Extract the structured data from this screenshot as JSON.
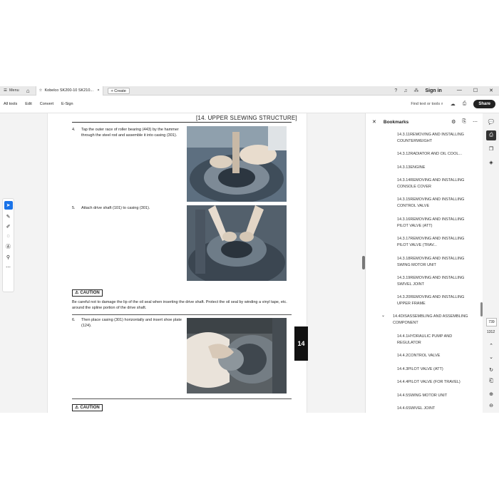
{
  "tabbar": {
    "menu_label": "Menu",
    "tab_title": "Kobelco SK200-10 SK210...",
    "create_label": "Create",
    "signin_label": "Sign in"
  },
  "toolbar": {
    "menus": [
      "All tools",
      "Edit",
      "Convert",
      "E-Sign"
    ],
    "find_label": "Find text or tools",
    "share_label": "Share"
  },
  "document": {
    "header": "[14.   UPPER SLEWING STRUCTURE]",
    "steps": [
      {
        "num": "4.",
        "text": "Tap the outer race of roller bearing (443) by the hammer through the steel rod and assemble it into casing (301)."
      },
      {
        "num": "5.",
        "text": "Attach drive shaft (101) to casing (301)."
      },
      {
        "num": "6.",
        "text": "Then place casing (301) horizontally and insert shoe plate (124)."
      }
    ],
    "caution_label": "CAUTION",
    "caution_text": "Be careful not to damage the lip of the oil seal when inserting the drive shaft. Protect the oil seal by winding a vinyl tape, etc. around the spline portion of the drive shaft.",
    "chapter_tab": "14"
  },
  "bookmarks": {
    "title": "Bookmarks",
    "items": [
      "14.3.11REMOVING AND INSTALLING COUNTERWEIGHT",
      "14.3.12RADIATOR AND OIL COOL...",
      "14.3.13ENGINE",
      "14.3.14REMOVING AND INSTALLING CONSOLE COVER",
      "14.3.15REMOVING AND INSTALLING CONTROL VALVE",
      "14.3.16REMOVING AND INSTALLING PILOT VALVE (ATT)",
      "14.3.17REMOVING AND INSTALLING PILOT VALVE (TRAV...",
      "14.3.18REMOVING AND INSTALLING SWING MOTOR UNIT",
      "14.3.19REMOVING AND INSTALLING SWIVEL JOINT",
      "14.3.20REMOVING AND INSTALLING UPPER FRAME"
    ],
    "parent": "14.4DISASSEMBLING AND ASSEMBLING COMPONENT",
    "children": [
      "14.4.1HYDRAULIC PUMP AND REGULATOR",
      "14.4.2CONTROL VALVE",
      "14.4.3PILOT VALVE (ATT)",
      "14.4.4PILOT VALVE (FOR TRAVEL)",
      "14.4.5SWING MOTOR UNIT",
      "14.4.6SWIVEL JOINT"
    ]
  },
  "pagination": {
    "current": "739",
    "total": "1312"
  }
}
